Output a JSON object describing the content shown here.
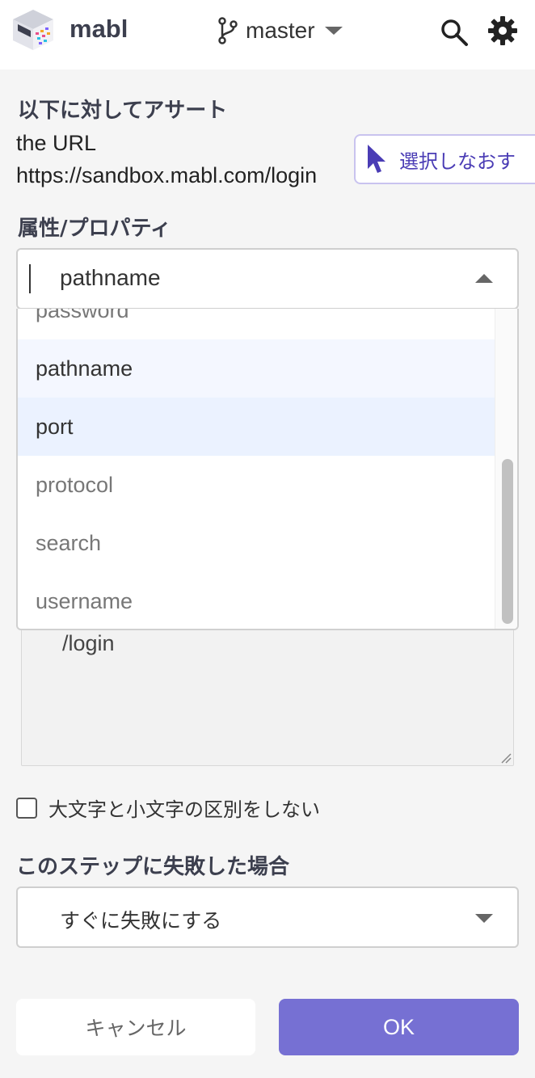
{
  "header": {
    "app_name": "mabl",
    "branch": "master",
    "logo_icon": "mabl-logo-icon",
    "branch_icon": "git-branch-icon",
    "search_icon": "search-icon",
    "settings_icon": "gear-icon"
  },
  "assert_target": {
    "heading": "以下に対してアサート",
    "line1": "the URL",
    "line2": "https://sandbox.mabl.com/login",
    "reselect_label": "選択しなおす",
    "reselect_icon": "cursor-icon"
  },
  "property": {
    "label": "属性/プロパティ",
    "selected": "pathname",
    "options": [
      {
        "label": "password"
      },
      {
        "label": "pathname"
      },
      {
        "label": "port"
      },
      {
        "label": "protocol"
      },
      {
        "label": "search"
      },
      {
        "label": "username"
      }
    ],
    "active_index": 1,
    "hover_index": 2
  },
  "expected_value": "/login",
  "case_insensitive_label": "大文字と小文字の区別をしない",
  "case_insensitive_checked": false,
  "on_failure": {
    "label": "このステップに失敗した場合",
    "selected": "すぐに失敗にする"
  },
  "buttons": {
    "cancel": "キャンセル",
    "ok": "OK"
  },
  "colors": {
    "primary": "#7670d3",
    "accent_text": "#4a3cb5",
    "hover_bg": "#ebf2ff"
  }
}
